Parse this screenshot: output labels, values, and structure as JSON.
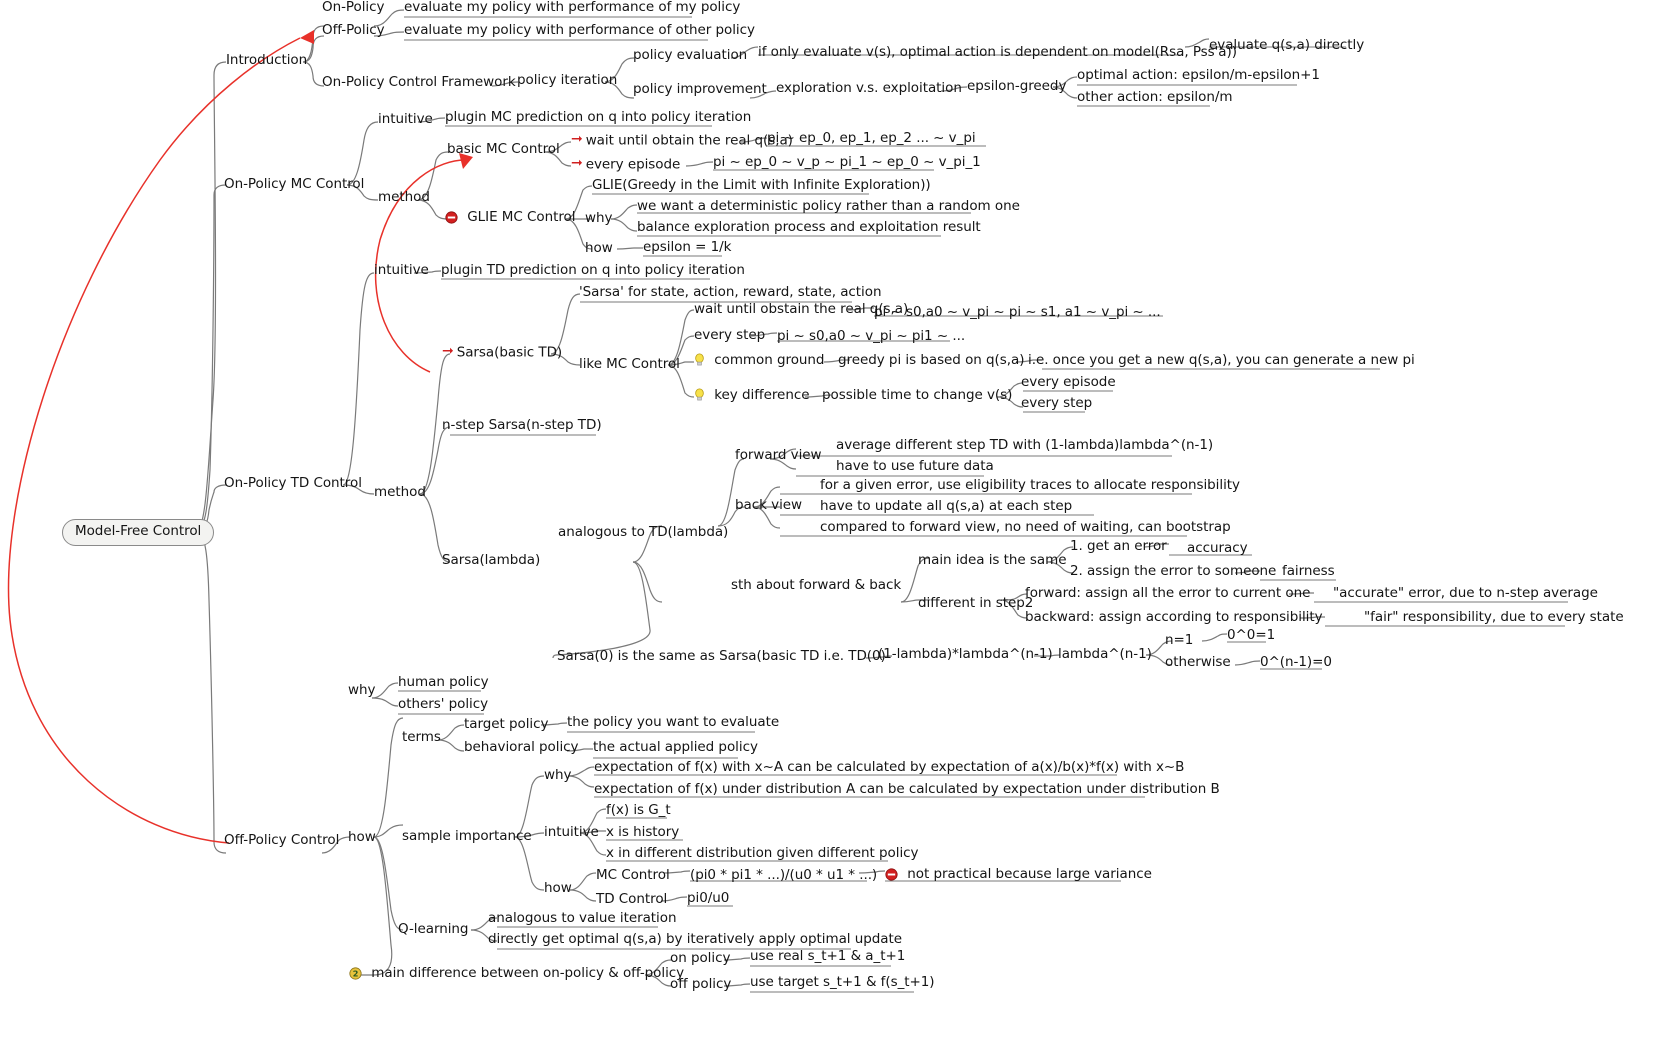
{
  "title": "Model-Free Control mind map",
  "root": {
    "label": "Model-Free Control"
  },
  "colors": {
    "accent_red": "#e02020",
    "link_gray": "#7a7a7a",
    "text": "#141414",
    "root_fill": "#f3f3f1",
    "bulb_yellow": "#f2d21e",
    "stop_red": "#d32020",
    "num_green": "#3c8a3c"
  },
  "nodes": {
    "introduction": "Introduction",
    "on_policy": "On-Policy",
    "on_policy_desc": "evaluate my policy with performance of my policy",
    "off_policy": "Off-Policy",
    "off_policy_desc": "evaluate my policy with performance of other policy",
    "on_policy_control_framework": "On-Policy Control Framework",
    "policy_iteration": "policy iteration",
    "policy_evaluation": "policy evaluation",
    "policy_evaluation_desc": "if only evaluate v(s), optimal action is dependent on model(Rsa, Pss'a))",
    "evaluate_q_directly": "evaluate q(s,a) directly",
    "policy_improvement": "policy improvement",
    "exploration_vs_exploitation": "exploration v.s. exploitation",
    "epsilon_greedy": "epsilon-greedy",
    "optimal_action": "optimal action: epsilon/m-epsilon+1",
    "other_action": "other action: epsilon/m",
    "on_policy_mc_control": "On-Policy MC Control",
    "mc_intuitive": "intuitive",
    "mc_intuitive_desc": "plugin MC prediction on q into policy iteration",
    "mc_method": "method",
    "basic_mc_control": "basic MC Control",
    "basic_mc_wait": "wait until obtain the real q(s,a)",
    "basic_mc_wait_desc": "pi ~ ep_0, ep_1, ep_2 ... ~ v_pi",
    "basic_mc_every_episode": "every episode",
    "basic_mc_every_episode_desc": "pi ~ ep_0 ~ v_p ~ pi_1 ~ ep_0 ~ v_pi_1",
    "glie_mc_control": "GLIE MC Control",
    "glie_full": "GLIE(Greedy in the Limit with Infinite Exploration))",
    "glie_why": "why",
    "glie_why_1": "we want a deterministic policy rather than a random one",
    "glie_why_2": "balance exploration process and exploitation result",
    "glie_how": "how",
    "glie_how_1": "epsilon = 1/k",
    "on_policy_td_control": "On-Policy TD Control",
    "td_intuitive": "intuitive",
    "td_intuitive_desc": "plugin TD prediction on q into policy iteration",
    "td_method": "method",
    "sarsa_basic_td": "Sarsa(basic TD)",
    "sarsa_acronym": "'Sarsa' for state, action, reward, state, action",
    "like_mc_control": "like MC Control",
    "sarsa_wait": "wait until obstain the real q(s,a)",
    "sarsa_wait_desc": "pi ~ s0,a0 ~ v_pi ~ pi ~ s1, a1 ~ v_pi ~ ...",
    "sarsa_every_step": "every step",
    "sarsa_every_step_desc": "pi ~ s0,a0 ~ v_pi ~ pi1 ~ ...",
    "common_ground": "common ground",
    "common_ground_desc": "greedy pi is based on q(s,a)",
    "common_ground_desc2": "i.e. once you get a new q(s,a), you can generate a new pi",
    "key_difference": "key difference",
    "key_difference_desc": "possible time to change v(s)",
    "key_diff_every_episode": "every episode",
    "key_diff_every_step": "every step",
    "n_step_sarsa": "n-step Sarsa(n-step TD)",
    "sarsa_lambda": "Sarsa(lambda)",
    "analogous_td_lambda": "analogous to TD(lambda)",
    "forward_view": "forward view",
    "forward_view_1": "average different step TD with (1-lambda)lambda^(n-1)",
    "forward_view_2": "have to use future data",
    "back_view": "back view",
    "back_view_1": "for a given error, use eligibility traces to allocate responsibility",
    "back_view_2": "have to update all q(s,a) at each step",
    "back_view_3": "compared to forward view, no need of waiting, can bootstrap",
    "sth_about_fwd_back": "sth about forward & back",
    "main_idea_same": "main idea is the same",
    "step_1": "1. get an error",
    "step_1_desc": "accuracy",
    "step_2": "2. assign the error to someone",
    "step_2_desc": "fairness",
    "different_in_step2": "different in step2",
    "forward_assign": "forward: assign all the error to current one",
    "forward_assign_desc": "\"accurate\" error, due to n-step average",
    "backward_assign": "backward: assign according to responsibility",
    "backward_assign_desc": "\"fair\" responsibility, due to every state",
    "sarsa0_same": "Sarsa(0) is the same as Sarsa(basic TD i.e. TD(0)",
    "sarsa0_formula": "(1-lambda)*lambda^(n-1)",
    "lambda_n1": "lambda^(n-1)",
    "n_eq_1": "n=1",
    "n_eq_1_desc": "0^0=1",
    "otherwise": "otherwise",
    "otherwise_desc": "0^(n-1)=0",
    "off_policy_control": "Off-Policy Control",
    "op_why": "why",
    "op_why_1": "human policy",
    "op_why_2": "others' policy",
    "op_how": "how",
    "op_terms": "terms",
    "target_policy": "target policy",
    "target_policy_desc": "the policy you want to evaluate",
    "behavioral_policy": "behavioral policy",
    "behavioral_policy_desc": "the actual applied policy",
    "sample_importance": "sample importance",
    "si_why": "why",
    "si_why_1": "expectation of f(x) with x~A can be calculated by expectation of a(x)/b(x)*f(x) with x~B",
    "si_why_2": "expectation of f(x) under distribution A can be calculated by expectation under distribution B",
    "si_intuitive": "intuitive",
    "si_intuitive_1": "f(x) is G_t",
    "si_intuitive_2": "x is history",
    "si_intuitive_3": "x in different distribution given different policy",
    "si_how": "how",
    "si_mc_control": "MC Control",
    "si_mc_control_desc": "(pi0 * pi1 * ...)/(u0 * u1 * ...)",
    "si_mc_control_note": "not practical because large variance",
    "si_td_control": "TD Control",
    "si_td_control_desc": "pi0/u0",
    "q_learning": "Q-learning",
    "q_learning_1": "analogous to value iteration",
    "q_learning_2": "directly get optimal q(s,a) by iteratively apply optimal update",
    "main_difference": "main difference between on-policy & off-policy",
    "on_policy_sub": "on policy",
    "on_policy_sub_desc": "use real s_t+1 & a_t+1",
    "off_policy_sub": "off policy",
    "off_policy_sub_desc": "use target s_t+1 & f(s_t+1)"
  }
}
